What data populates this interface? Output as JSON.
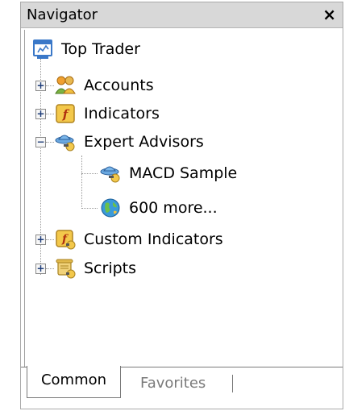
{
  "window": {
    "title": "Navigator",
    "close_glyph": "×"
  },
  "tree": {
    "root": {
      "label": "Top Trader",
      "icon": "terminal-icon"
    },
    "items": [
      {
        "label": "Accounts",
        "icon": "accounts-icon",
        "expander": "+"
      },
      {
        "label": "Indicators",
        "icon": "indicators-icon",
        "expander": "+"
      },
      {
        "label": "Expert Advisors",
        "icon": "expert-advisors-icon",
        "expander": "−",
        "children": [
          {
            "label": "MACD Sample",
            "icon": "expert-advisor-icon"
          },
          {
            "label": "600 more...",
            "icon": "globe-icon"
          }
        ]
      },
      {
        "label": "Custom Indicators",
        "icon": "custom-indicators-icon",
        "expander": "+"
      },
      {
        "label": "Scripts",
        "icon": "scripts-icon",
        "expander": "+"
      }
    ]
  },
  "tabs": [
    {
      "label": "Common",
      "active": true
    },
    {
      "label": "Favorites",
      "active": false
    }
  ]
}
